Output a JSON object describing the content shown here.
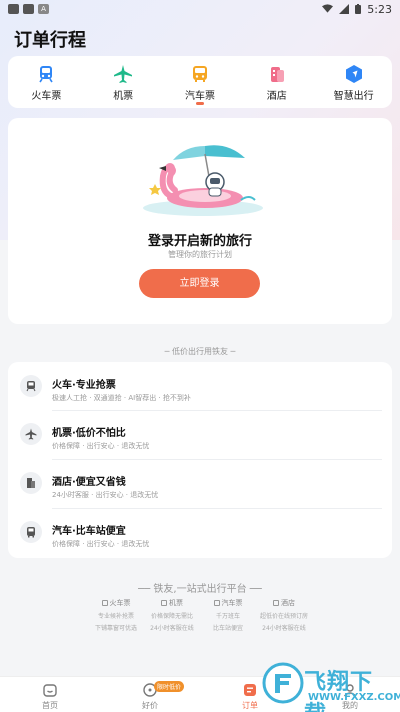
{
  "status_bar": {
    "time": "5:23"
  },
  "page_title": "订单行程",
  "categories": [
    {
      "label": "火车票",
      "icon": "train-icon",
      "color": "#2f86f6"
    },
    {
      "label": "机票",
      "icon": "plane-icon",
      "color": "#1fb98a"
    },
    {
      "label": "汽车票",
      "icon": "bus-icon",
      "color": "#f5a623"
    },
    {
      "label": "酒店",
      "icon": "hotel-icon",
      "color": "#f06d8a"
    },
    {
      "label": "智慧出行",
      "icon": "navigation-icon",
      "color": "#2f86f6"
    }
  ],
  "login": {
    "title": "登录开启新的旅行",
    "subtitle": "管理你的旅行计划",
    "button": "立即登录"
  },
  "section_title": "低价出行用铁友",
  "promos": [
    {
      "title": "火车·专业抢票",
      "subtitle": "极速人工抢 · 双通道抢 · AI智荐出 · 抢不到补",
      "icon": "train-icon"
    },
    {
      "title": "机票·低价不怕比",
      "subtitle": "价格保障 · 出行安心 · 退改无忧",
      "icon": "plane-icon"
    },
    {
      "title": "酒店·便宜又省钱",
      "subtitle": "24小时客服 · 出行安心 · 退改无忧",
      "icon": "hotel-icon"
    },
    {
      "title": "汽车·比车站便宜",
      "subtitle": "价格保障 · 出行安心 · 退改无忧",
      "icon": "bus-icon"
    }
  ],
  "platform": {
    "title": "铁友,一站式出行平台",
    "columns": [
      {
        "head": "火车票",
        "lines": [
          "专业候补抢票",
          "下铺靠窗可优选"
        ]
      },
      {
        "head": "机票",
        "lines": [
          "价格保障无需比",
          "24小时客服在线"
        ]
      },
      {
        "head": "汽车票",
        "lines": [
          "千万班车",
          "比车站便宜"
        ]
      },
      {
        "head": "酒店",
        "lines": [
          "超低价在线预订房",
          "24小时客服在线"
        ]
      }
    ]
  },
  "tabs": [
    {
      "label": "首页",
      "icon": "home-icon"
    },
    {
      "label": "好价",
      "icon": "compass-icon",
      "badge": "限时低价"
    },
    {
      "label": "订单",
      "icon": "order-icon",
      "active": true
    },
    {
      "label": "我的",
      "icon": "profile-icon"
    }
  ],
  "watermark": {
    "text": "飞翔下载",
    "url": "WWW.FXXZ.COM"
  },
  "colors": {
    "accent": "#f06d4b",
    "background": "#f4f5f7",
    "watermark": "#3fb1d8"
  }
}
